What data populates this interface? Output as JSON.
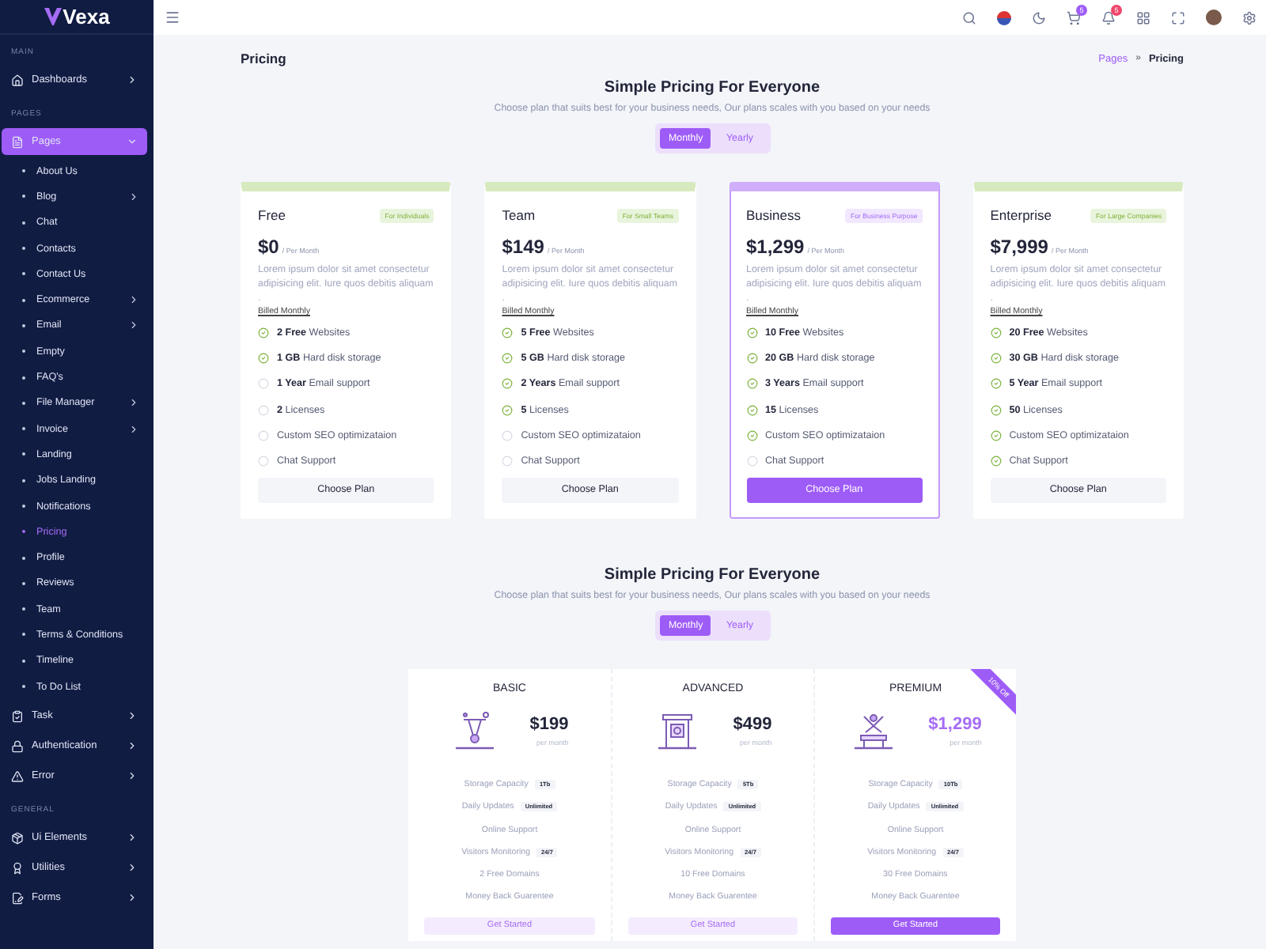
{
  "brand": "Vexa",
  "sidebar": {
    "sections": [
      {
        "label": "MAIN",
        "items": [
          {
            "label": "Dashboards",
            "selected": false,
            "expanded": false,
            "has_children": true
          }
        ]
      },
      {
        "label": "PAGES",
        "items": [
          {
            "label": "Pages",
            "selected": true,
            "expanded": true,
            "has_children": true,
            "children": [
              {
                "label": "About Us",
                "selected": false,
                "has_children": false
              },
              {
                "label": "Blog",
                "selected": false,
                "has_children": true
              },
              {
                "label": "Chat",
                "selected": false,
                "has_children": false
              },
              {
                "label": "Contacts",
                "selected": false,
                "has_children": false
              },
              {
                "label": "Contact Us",
                "selected": false,
                "has_children": false
              },
              {
                "label": "Ecommerce",
                "selected": false,
                "has_children": true
              },
              {
                "label": "Email",
                "selected": false,
                "has_children": true
              },
              {
                "label": "Empty",
                "selected": false,
                "has_children": false
              },
              {
                "label": "FAQ's",
                "selected": false,
                "has_children": false
              },
              {
                "label": "File Manager",
                "selected": false,
                "has_children": true
              },
              {
                "label": "Invoice",
                "selected": false,
                "has_children": true
              },
              {
                "label": "Landing",
                "selected": false,
                "has_children": false
              },
              {
                "label": "Jobs Landing",
                "selected": false,
                "has_children": false
              },
              {
                "label": "Notifications",
                "selected": false,
                "has_children": false
              },
              {
                "label": "Pricing",
                "selected": true,
                "has_children": false
              },
              {
                "label": "Profile",
                "selected": false,
                "has_children": false
              },
              {
                "label": "Reviews",
                "selected": false,
                "has_children": false
              },
              {
                "label": "Team",
                "selected": false,
                "has_children": false
              },
              {
                "label": "Terms & Conditions",
                "selected": false,
                "has_children": false
              },
              {
                "label": "Timeline",
                "selected": false,
                "has_children": false
              },
              {
                "label": "To Do List",
                "selected": false,
                "has_children": false
              }
            ]
          },
          {
            "label": "Task",
            "selected": false,
            "expanded": false,
            "has_children": true
          },
          {
            "label": "Authentication",
            "selected": false,
            "expanded": false,
            "has_children": true
          },
          {
            "label": "Error",
            "selected": false,
            "expanded": false,
            "has_children": true
          }
        ]
      },
      {
        "label": "GENERAL",
        "items": [
          {
            "label": "Ui Elements",
            "selected": false,
            "expanded": false,
            "has_children": true
          },
          {
            "label": "Utilities",
            "selected": false,
            "expanded": false,
            "has_children": true
          },
          {
            "label": "Forms",
            "selected": false,
            "expanded": false,
            "has_children": true
          }
        ]
      }
    ]
  },
  "header": {
    "cart_count": "5",
    "notification_count": "5"
  },
  "page_title": "Pricing",
  "breadcrumb_separator": "»",
  "breadcrumb": [
    {
      "label": "Pages",
      "selected": false
    },
    {
      "label": "Pricing",
      "selected": true
    }
  ],
  "sections": [
    {
      "heading": "Simple Pricing For Everyone",
      "subtitle": "Choose plan that suits best for your business needs, Our plans scales with you based on your needs",
      "toggle": [
        {
          "label": "Monthly",
          "selected": true
        },
        {
          "label": "Yearly",
          "selected": false
        }
      ],
      "plans": [
        {
          "name": "Free",
          "badge": "For Individuals",
          "price": "$0",
          "period": "/ Per Month",
          "description": "Lorem ipsum dolor sit amet consectetur adipisicing elit. Iure quos debitis aliquam .",
          "billing": "Billed Monthly",
          "selected": false,
          "button": "Choose Plan",
          "features": [
            {
              "text": "**2 Free** Websites",
              "included": true
            },
            {
              "text": "**1 GB** Hard disk storage",
              "included": true
            },
            {
              "text": "**1 Year** Email support",
              "included": false
            },
            {
              "text": "**2** Licenses",
              "included": false
            },
            {
              "text": "Custom SEO optimizataion",
              "included": false
            },
            {
              "text": "Chat Support",
              "included": false
            }
          ]
        },
        {
          "name": "Team",
          "badge": "For Small Teams",
          "price": "$149",
          "period": "/ Per Month",
          "description": "Lorem ipsum dolor sit amet consectetur adipisicing elit. Iure quos debitis aliquam .",
          "billing": "Billed Monthly",
          "selected": false,
          "button": "Choose Plan",
          "features": [
            {
              "text": "**5 Free** Websites",
              "included": true
            },
            {
              "text": "**5 GB** Hard disk storage",
              "included": true
            },
            {
              "text": "**2 Years** Email support",
              "included": true
            },
            {
              "text": "**5** Licenses",
              "included": true
            },
            {
              "text": "Custom SEO optimizataion",
              "included": false
            },
            {
              "text": "Chat Support",
              "included": false
            }
          ]
        },
        {
          "name": "Business",
          "badge": "For Business Purpose",
          "price": "$1,299",
          "period": "/ Per Month",
          "description": "Lorem ipsum dolor sit amet consectetur adipisicing elit. Iure quos debitis aliquam .",
          "billing": "Billed Monthly",
          "selected": true,
          "button": "Choose Plan",
          "features": [
            {
              "text": "**10 Free** Websites",
              "included": true
            },
            {
              "text": "**20 GB** Hard disk storage",
              "included": true
            },
            {
              "text": "**3 Years** Email support",
              "included": true
            },
            {
              "text": "**15** Licenses",
              "included": true
            },
            {
              "text": "Custom SEO optimizataion",
              "included": true
            },
            {
              "text": "Chat Support",
              "included": false
            }
          ]
        },
        {
          "name": "Enterprise",
          "badge": "For Large Companies",
          "price": "$7,999",
          "period": "/ Per Month",
          "description": "Lorem ipsum dolor sit amet consectetur adipisicing elit. Iure quos debitis aliquam .",
          "billing": "Billed Monthly",
          "selected": false,
          "button": "Choose Plan",
          "features": [
            {
              "text": "**20 Free** Websites",
              "included": true
            },
            {
              "text": "**30 GB** Hard disk storage",
              "included": true
            },
            {
              "text": "**5 Year** Email support",
              "included": true
            },
            {
              "text": "**50** Licenses",
              "included": true
            },
            {
              "text": "Custom SEO optimizataion",
              "included": true
            },
            {
              "text": "Chat Support",
              "included": true
            }
          ]
        }
      ]
    },
    {
      "heading": "Simple Pricing For Everyone",
      "subtitle": "Choose plan that suits best for your business needs, Our plans scales with you based on your needs",
      "toggle": [
        {
          "label": "Monthly",
          "selected": true
        },
        {
          "label": "Yearly",
          "selected": false
        }
      ],
      "tiers": [
        {
          "name": "BASIC",
          "price": "$199",
          "period": "per month",
          "selected": false,
          "button": "Get Started",
          "features": [
            {
              "text": "Storage Capacity",
              "tag": "1Tb"
            },
            {
              "text": "Daily Updates",
              "tag": "Unlimited"
            },
            {
              "text": "Online Support"
            },
            {
              "text": "Visitors Monitoring",
              "tag": "24/7"
            },
            {
              "text": "2 Free Domains"
            },
            {
              "text": "Money Back Guarentee"
            }
          ]
        },
        {
          "name": "ADVANCED",
          "price": "$499",
          "period": "per month",
          "selected": false,
          "button": "Get Started",
          "features": [
            {
              "text": "Storage Capacity",
              "tag": "5Tb"
            },
            {
              "text": "Daily Updates",
              "tag": "Unlimited"
            },
            {
              "text": "Online Support"
            },
            {
              "text": "Visitors Monitoring",
              "tag": "24/7"
            },
            {
              "text": "10 Free Domains"
            },
            {
              "text": "Money Back Guarentee"
            }
          ]
        },
        {
          "name": "PREMIUM",
          "price": "$1,299",
          "period": "per month",
          "selected": true,
          "ribbon": "10% Off",
          "button": "Get Started",
          "features": [
            {
              "text": "Storage Capacity",
              "tag": "10Tb"
            },
            {
              "text": "Daily Updates",
              "tag": "Unlimited"
            },
            {
              "text": "Online Support"
            },
            {
              "text": "Visitors Monitoring",
              "tag": "24/7"
            },
            {
              "text": "30 Free Domains"
            },
            {
              "text": "Money Back Guarentee"
            }
          ]
        }
      ]
    }
  ]
}
